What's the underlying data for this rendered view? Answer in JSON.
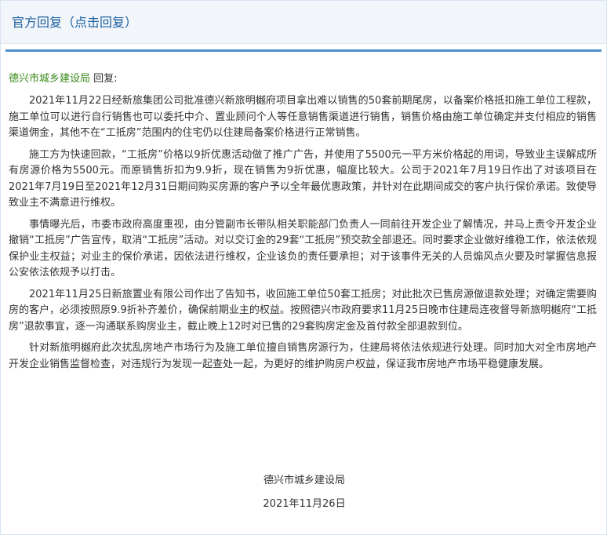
{
  "header": {
    "title": "官方回复（点击回复）"
  },
  "reply": {
    "department": "德兴市城乡建设局",
    "suffix": " 回复:"
  },
  "paragraphs": [
    "2021年11月22日经新旅集团公司批准德兴新旅明樾府项目拿出难以销售的50套前期尾房，以备案价格抵扣施工单位工程款，施工单位可以进行自行销售也可以委托中介、置业顾问个人等任意销售渠道进行销售，销售价格由施工单位确定并支付相应的销售渠道佣金，其他不在“工抵房”范围内的住宅仍以住建局备案价格进行正常销售。",
    "施工方为快速回款，“工抵房”价格以9折优惠活动做了推广广告，并使用了5500元一平方米价格起的用词，导致业主误解成所有房源价格为5500元。而原销售折扣为9.9折，现在销售为9折优惠，幅度比较大。公司于2021年7月19日作出了对该项目在2021年7月19日至2021年12月31日期间购买房源的客户予以全年最优惠政策，并针对在此期间成交的客户执行保价承诺。致使导致业主不满意进行维权。",
    "事情曝光后，市委市政府高度重视，由分管副市长带队相关职能部门负责人一同前往开发企业了解情况，并马上责令开发企业撤销“工抵房”广告宣传，取消“工抵房”活动。对以交订金的29套“工抵房”预交款全部退还。同时要求企业做好维稳工作，依法依规保护业主权益；对业主的保价承诺，因依法进行维权，企业该负的责任要承担；对于该事件无关的人员煽风点火要及时掌握信息报公安依法依规予以打击。",
    "2021年11月25日新旅置业有限公司作出了告知书，收回施工单位50套工抵房；对此批次已售房源做退款处理；对确定需要购房的客户，必须按照原9.9折补齐差价，确保前期业主的权益。按照德兴市政府要求11月25日晚市住建局连夜督导新旅明樾府“工抵房”退款事宜，逐一沟通联系购房业主，截止晚上12时对已售的29套购房定金及首付款全部退款到位。",
    "针对新旅明樾府此次扰乱房地产市场行为及施工单位擅自销售房源行为，住建局将依法依规进行处理。同时加大对全市房地产开发企业销售监督检查，对违规行为发现一起查处一起，为更好的维护购房户权益，保证我市房地产市场平稳健康发展。"
  ],
  "signature": {
    "department": "德兴市城乡建设局",
    "date": "2021年11月26日"
  },
  "colors": {
    "header_text": "#1b5f9f",
    "divider": "#4a8fc9",
    "department_green": "#3a8a1a"
  }
}
